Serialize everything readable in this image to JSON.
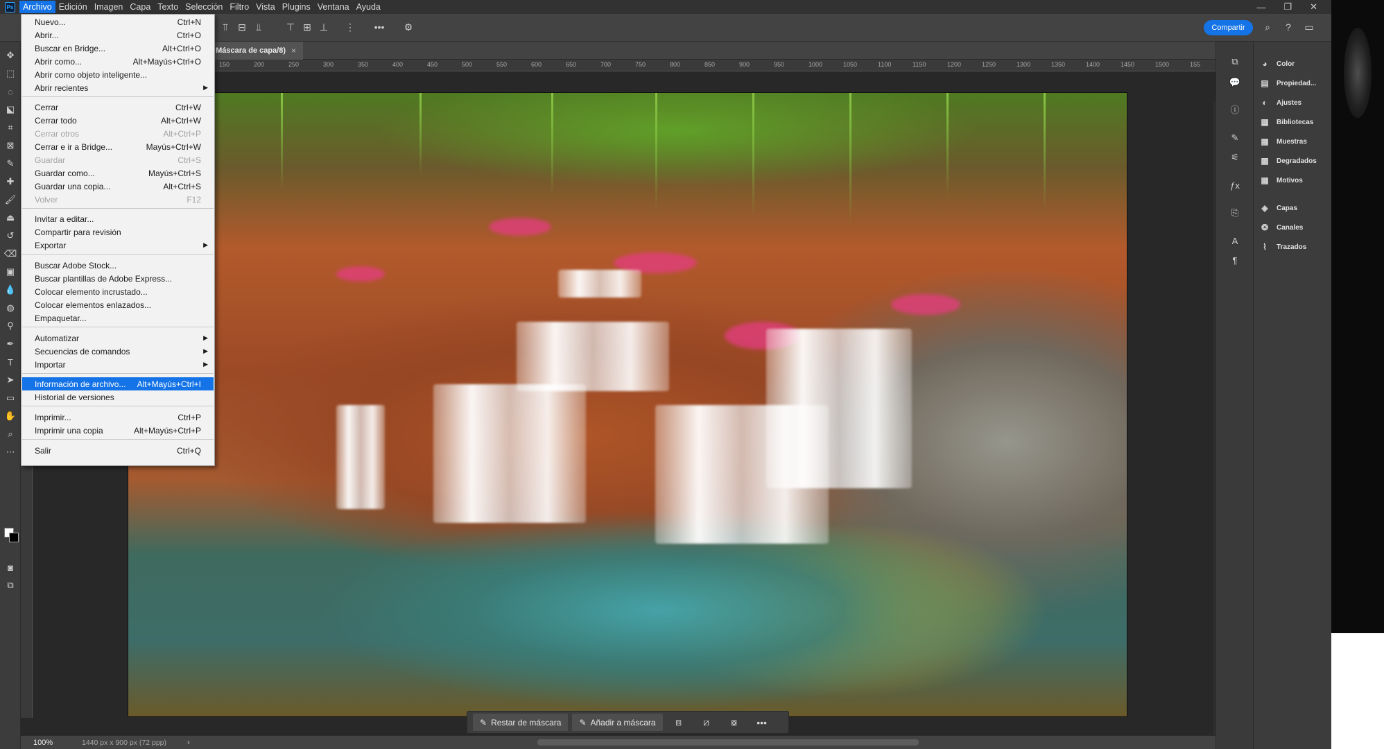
{
  "menubar": {
    "logo": "Ps",
    "items": [
      "Archivo",
      "Edición",
      "Imagen",
      "Capa",
      "Texto",
      "Selección",
      "Filtro",
      "Vista",
      "Plugins",
      "Ventana",
      "Ayuda"
    ],
    "active": "Archivo"
  },
  "window_controls": {
    "minimize": "—",
    "restore": "❐",
    "close": "✕"
  },
  "options_bar": {
    "share_label": "Compartir",
    "more": "•••"
  },
  "document": {
    "tab_title": ". Máscara de capa/8)",
    "tab_close": "×",
    "ruler_ticks": [
      "150",
      "200",
      "250",
      "300",
      "350",
      "400",
      "450",
      "500",
      "550",
      "600",
      "650",
      "700",
      "750",
      "800",
      "850",
      "900",
      "950",
      "1000",
      "1050",
      "1100",
      "1150",
      "1200",
      "1250",
      "1300",
      "1350",
      "1400",
      "1450",
      "1500",
      "155"
    ]
  },
  "context_bar": {
    "restore_mask": "Restar de máscara",
    "add_mask": "Añadir a máscara",
    "more": "•••"
  },
  "status_bar": {
    "zoom": "100%",
    "doc_info": "1440 px x 900 px (72 ppp)",
    "arrow": "›"
  },
  "panels": [
    {
      "label": "Color",
      "icon": "color-wheel-icon",
      "glyph": "◕"
    },
    {
      "label": "Propiedad...",
      "icon": "properties-icon",
      "glyph": "▤"
    },
    {
      "label": "Ajustes",
      "icon": "adjustments-icon",
      "glyph": "◐"
    },
    {
      "label": "Bibliotecas",
      "icon": "libraries-icon",
      "glyph": "▦"
    },
    {
      "label": "Muestras",
      "icon": "swatches-icon",
      "glyph": "▦"
    },
    {
      "label": "Degradados",
      "icon": "gradients-icon",
      "glyph": "▩"
    },
    {
      "label": "Motivos",
      "icon": "patterns-icon",
      "glyph": "▦"
    },
    {
      "label": "Capas",
      "icon": "layers-icon",
      "glyph": "◈"
    },
    {
      "label": "Canales",
      "icon": "channels-icon",
      "glyph": "❂"
    },
    {
      "label": "Trazados",
      "icon": "paths-icon",
      "glyph": "⌇"
    }
  ],
  "file_menu": {
    "items": [
      {
        "label": "Nuevo...",
        "shortcut": "Ctrl+N"
      },
      {
        "label": "Abrir...",
        "shortcut": "Ctrl+O"
      },
      {
        "label": "Buscar en Bridge...",
        "shortcut": "Alt+Ctrl+O"
      },
      {
        "label": "Abrir como...",
        "shortcut": "Alt+Mayús+Ctrl+O"
      },
      {
        "label": "Abrir como objeto inteligente...",
        "shortcut": ""
      },
      {
        "label": "Abrir recientes",
        "shortcut": "",
        "submenu": true
      },
      {
        "label": "Cerrar",
        "shortcut": "Ctrl+W"
      },
      {
        "label": "Cerrar todo",
        "shortcut": "Alt+Ctrl+W"
      },
      {
        "label": "Cerrar otros",
        "shortcut": "Alt+Ctrl+P",
        "disabled": true
      },
      {
        "label": "Cerrar e ir a Bridge...",
        "shortcut": "Mayús+Ctrl+W"
      },
      {
        "label": "Guardar",
        "shortcut": "Ctrl+S",
        "disabled": true
      },
      {
        "label": "Guardar como...",
        "shortcut": "Mayús+Ctrl+S"
      },
      {
        "label": "Guardar una copia...",
        "shortcut": "Alt+Ctrl+S"
      },
      {
        "label": "Volver",
        "shortcut": "F12",
        "disabled": true
      },
      {
        "label": "Invitar a editar...",
        "shortcut": ""
      },
      {
        "label": "Compartir para revisión",
        "shortcut": ""
      },
      {
        "label": "Exportar",
        "shortcut": "",
        "submenu": true
      },
      {
        "label": "Buscar Adobe Stock...",
        "shortcut": ""
      },
      {
        "label": "Buscar plantillas de Adobe Express...",
        "shortcut": ""
      },
      {
        "label": "Colocar elemento incrustado...",
        "shortcut": ""
      },
      {
        "label": "Colocar elementos enlazados...",
        "shortcut": ""
      },
      {
        "label": "Empaquetar...",
        "shortcut": ""
      },
      {
        "label": "Automatizar",
        "shortcut": "",
        "submenu": true
      },
      {
        "label": "Secuencias de comandos",
        "shortcut": "",
        "submenu": true
      },
      {
        "label": "Importar",
        "shortcut": "",
        "submenu": true
      },
      {
        "label": "Información de archivo...",
        "shortcut": "Alt+Mayús+Ctrl+I",
        "highlighted": true
      },
      {
        "label": "Historial de versiones",
        "shortcut": ""
      },
      {
        "label": "Imprimir...",
        "shortcut": "Ctrl+P"
      },
      {
        "label": "Imprimir una copia",
        "shortcut": "Alt+Mayús+Ctrl+P"
      },
      {
        "label": "Salir",
        "shortcut": "Ctrl+Q"
      }
    ]
  },
  "colors": {
    "accent": "#1473e6",
    "app_bg": "#535353",
    "panel_bg": "#3c3c3c",
    "menu_bg": "#f2f2f2"
  }
}
